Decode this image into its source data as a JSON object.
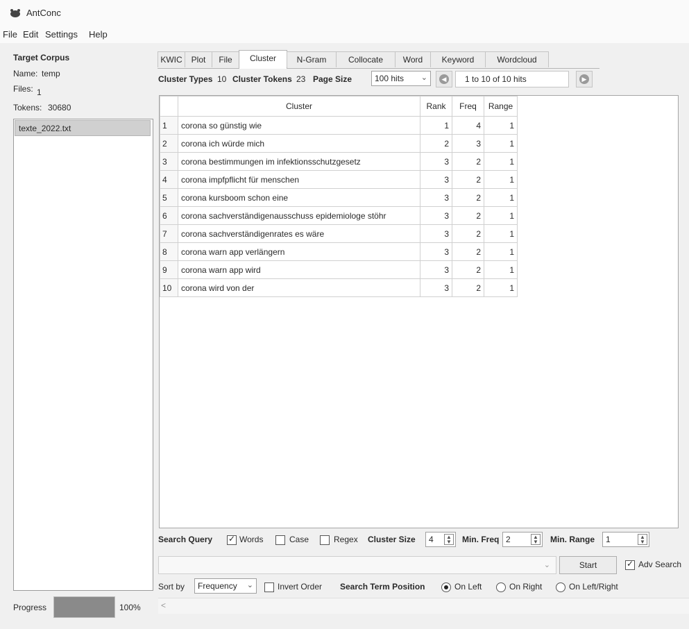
{
  "window": {
    "title": "AntConc"
  },
  "menu": [
    "File",
    "Edit",
    "Settings",
    "Help"
  ],
  "left_panel": {
    "heading": "Target Corpus",
    "name_label": "Name:",
    "name_value": "temp",
    "files_label": "Files:",
    "files_value": "1",
    "tokens_label": "Tokens:",
    "tokens_value": "30680",
    "files": [
      "texte_2022.txt"
    ],
    "progress_label": "Progress",
    "progress_value": "100%",
    "progress_fraction": 1.0
  },
  "tabs": [
    "KWIC",
    "Plot",
    "File",
    "Cluster",
    "N-Gram",
    "Collocate",
    "Word",
    "Keyword",
    "Wordcloud"
  ],
  "active_tab": "Cluster",
  "stats": {
    "types_label": "Cluster Types",
    "types_value": "10",
    "tokens_label": "Cluster Tokens",
    "tokens_value": "23",
    "page_size_label": "Page Size",
    "page_size_value": "100 hits",
    "hits_text": "1 to 10 of 10 hits"
  },
  "table": {
    "headers": [
      "Cluster",
      "Rank",
      "Freq",
      "Range"
    ],
    "rows": [
      [
        "1",
        "corona so günstig wie",
        "1",
        "4",
        "1"
      ],
      [
        "2",
        "corona ich würde mich",
        "2",
        "3",
        "1"
      ],
      [
        "3",
        "corona bestimmungen im infektionsschutzgesetz",
        "3",
        "2",
        "1"
      ],
      [
        "4",
        "corona impfpflicht für menschen",
        "3",
        "2",
        "1"
      ],
      [
        "5",
        "corona kursboom schon eine",
        "3",
        "2",
        "1"
      ],
      [
        "6",
        "corona sachverständigenausschuss epidemiologe stöhr",
        "3",
        "2",
        "1"
      ],
      [
        "7",
        "corona sachverständigenrates es wäre",
        "3",
        "2",
        "1"
      ],
      [
        "8",
        "corona warn app verlängern",
        "3",
        "2",
        "1"
      ],
      [
        "9",
        "corona warn app wird",
        "3",
        "2",
        "1"
      ],
      [
        "10",
        "corona wird von der",
        "3",
        "2",
        "1"
      ]
    ]
  },
  "search": {
    "query_label": "Search Query",
    "words_label": "Words",
    "words_checked": true,
    "case_label": "Case",
    "case_checked": false,
    "regex_label": "Regex",
    "regex_checked": false,
    "cluster_size_label": "Cluster Size",
    "cluster_size_value": "4",
    "min_freq_label": "Min. Freq",
    "min_freq_value": "2",
    "min_range_label": "Min. Range",
    "min_range_value": "1",
    "query_value": "",
    "start_label": "Start",
    "adv_search_label": "Adv Search",
    "adv_search_checked": true
  },
  "sort": {
    "sort_by_label": "Sort by",
    "sort_by_value": "Frequency",
    "invert_label": "Invert Order",
    "invert_checked": false,
    "position_label": "Search Term Position",
    "options": [
      "On Left",
      "On Right",
      "On Left/Right"
    ],
    "selected": "On Left"
  }
}
